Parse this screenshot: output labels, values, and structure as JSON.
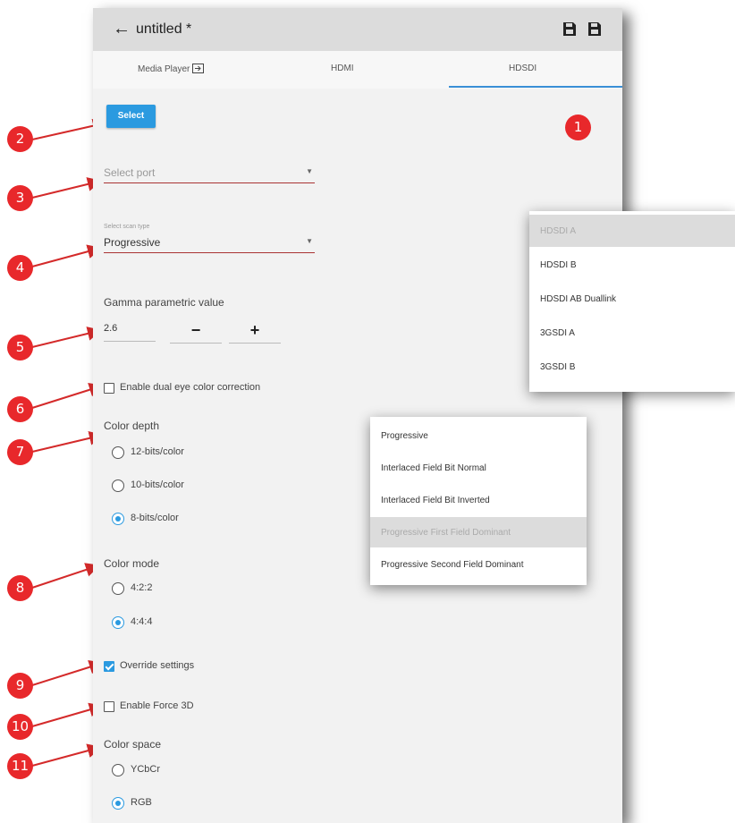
{
  "header": {
    "title": "untitled *"
  },
  "tabs": [
    {
      "label": "Media Player"
    },
    {
      "label": "HDMI"
    },
    {
      "label": "HDSDI"
    }
  ],
  "select_button": {
    "label": "Select"
  },
  "port_select": {
    "placeholder": "Select port"
  },
  "scan_type": {
    "label": "Select scan type",
    "value": "Progressive"
  },
  "gamma": {
    "label": "Gamma parametric value",
    "value": "2.6",
    "minus": "−",
    "plus": "+"
  },
  "dual_eye": {
    "label": "Enable dual eye color correction",
    "checked": false
  },
  "color_depth": {
    "label": "Color depth",
    "options": [
      {
        "label": "12-bits/color"
      },
      {
        "label": "10-bits/color"
      },
      {
        "label": "8-bits/color"
      }
    ],
    "selected": "8-bits/color"
  },
  "color_mode": {
    "label": "Color mode",
    "options": [
      {
        "label": "4:2:2"
      },
      {
        "label": "4:4:4"
      }
    ],
    "selected": "4:4:4"
  },
  "override": {
    "label": "Override settings",
    "checked": true
  },
  "force3d": {
    "label": "Enable Force 3D",
    "checked": false
  },
  "color_space": {
    "label": "Color space",
    "options": [
      {
        "label": "YCbCr"
      },
      {
        "label": "RGB"
      }
    ],
    "selected": "RGB"
  },
  "port_dropdown": {
    "items": [
      {
        "label": "HDSDI A"
      },
      {
        "label": "HDSDI B"
      },
      {
        "label": "HDSDI AB Duallink"
      },
      {
        "label": "3GSDI A"
      },
      {
        "label": "3GSDI B"
      }
    ],
    "highlighted": "HDSDI A"
  },
  "scan_dropdown": {
    "items": [
      {
        "label": "Progressive"
      },
      {
        "label": "Interlaced Field Bit Normal"
      },
      {
        "label": "Interlaced Field Bit Inverted"
      },
      {
        "label": "Progressive First Field Dominant"
      },
      {
        "label": "Progressive Second Field Dominant"
      }
    ],
    "highlighted": "Progressive First Field Dominant"
  },
  "callouts": [
    "1",
    "2",
    "3",
    "4",
    "5",
    "6",
    "7",
    "8",
    "9",
    "10",
    "11"
  ],
  "colors": {
    "accent": "#2b9ae0",
    "callout": "#e8282b",
    "arrow": "#d42a2a"
  }
}
